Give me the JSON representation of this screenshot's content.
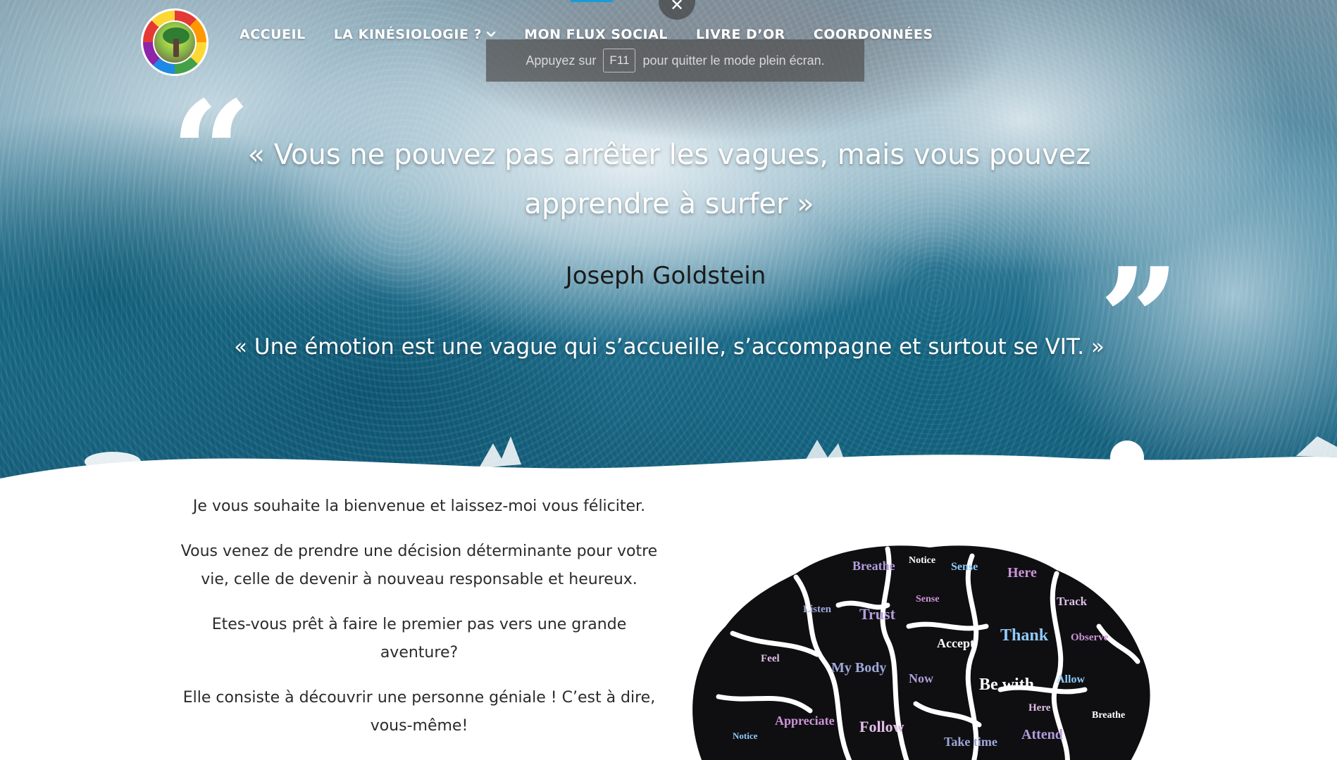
{
  "nav": {
    "items": [
      {
        "label": "ACCUEIL"
      },
      {
        "label": "LA KINÉSIOLOGIE ?",
        "has_dropdown": true
      },
      {
        "label": "MON FLUX SOCIAL"
      },
      {
        "label": "LIVRE D’OR"
      },
      {
        "label": "COORDONNÉES"
      }
    ]
  },
  "fullscreen_notice": {
    "before": "Appuyez sur",
    "key": "F11",
    "after": "pour quitter le mode plein écran.",
    "close_glyph": "✕"
  },
  "hero": {
    "quote_open_glyph": "“",
    "quote_close_glyph": "”",
    "quote": "« Vous ne pouvez pas arrêter les vagues, mais vous pouvez apprendre à surfer »",
    "author": "Joseph Goldstein",
    "subtitle": "« Une émotion est une vague qui s’accueille, s’accompagne et surtout se VIT. »"
  },
  "intro": {
    "p1": "Je vous souhaite la bienvenue et laissez-moi vous féliciter.",
    "p2": "Vous venez de prendre une décision déterminante pour votre vie, celle de devenir à nouveau responsable et heureux.",
    "p3": "Etes-vous prêt à faire le premier  pas vers une grande aventure?",
    "p4": "Elle consiste à découvrir une personne géniale ! C’est à dire, vous-même!"
  },
  "brain_words": [
    "Breathe",
    "Notice",
    "Sense",
    "Here",
    "Track",
    "Listen",
    "Trust",
    "Accept",
    "Thank",
    "Observe",
    "Feel",
    "My Body",
    "Now",
    "Be with",
    "Allow",
    "Appreciate",
    "Follow",
    "Take time",
    "Attend"
  ],
  "colors": {
    "nav_text": "#ffffff",
    "body_text": "#2b2b2b",
    "author_text": "#1a1a1a"
  }
}
